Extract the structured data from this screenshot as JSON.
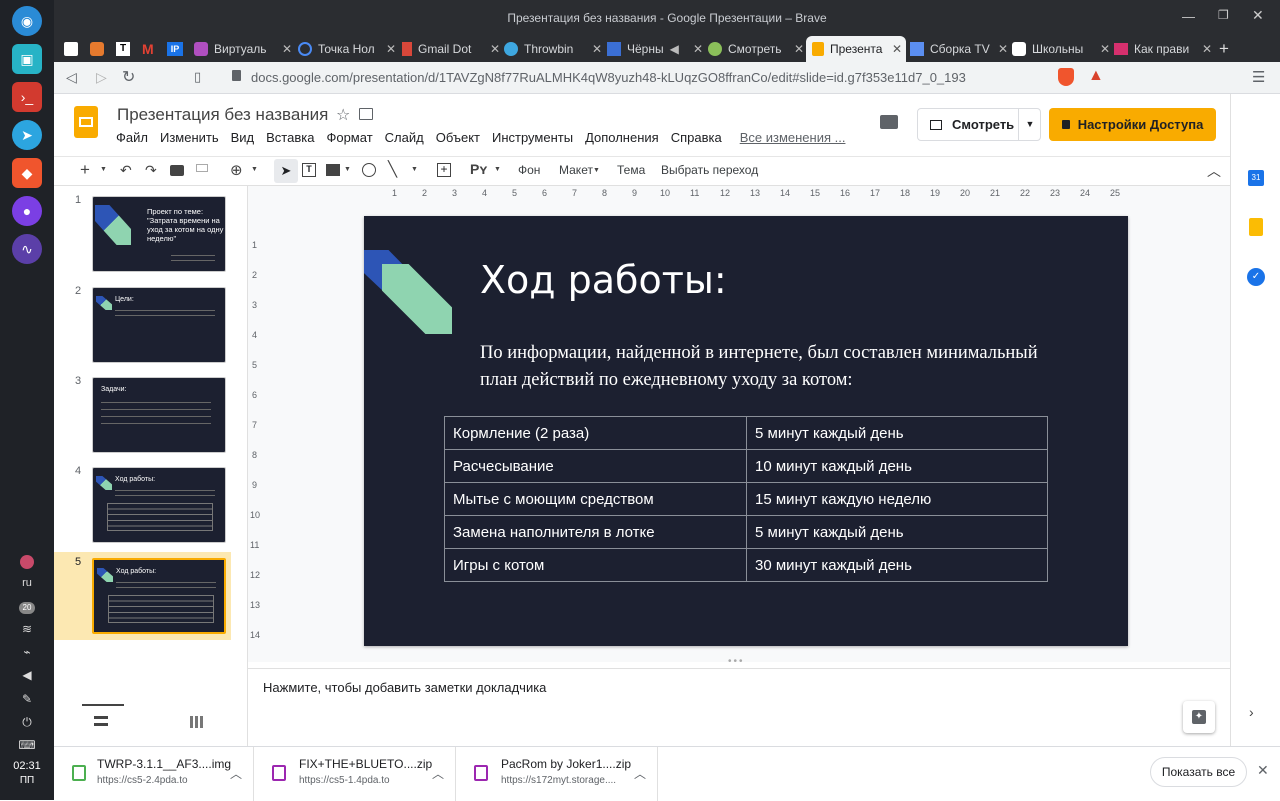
{
  "window": {
    "title": "Презентация без названия - Google Презентации – Brave"
  },
  "os_tray": {
    "lang": "ru",
    "badge": "20",
    "time": "02:31",
    "day": "ПП"
  },
  "tabs": [
    {
      "label": "Виртуаль"
    },
    {
      "label": "Точка Нол"
    },
    {
      "label": "Gmail Dot"
    },
    {
      "label": "Throwbin"
    },
    {
      "label": "Чёрны"
    },
    {
      "label": "Смотреть"
    },
    {
      "label": "Презента"
    },
    {
      "label": "Сборка TV"
    },
    {
      "label": "Школьны"
    },
    {
      "label": "Как прави"
    }
  ],
  "address": {
    "url": "docs.google.com/presentation/d/1TAVZgN8f77RuALMHK4qW8yuzh48-kLUqzGO8ffranCo/edit#slide=id.g7f353e11d7_0_193"
  },
  "doc": {
    "title": "Презентация без названия",
    "menu": [
      "Файл",
      "Изменить",
      "Вид",
      "Вставка",
      "Формат",
      "Слайд",
      "Объект",
      "Инструменты",
      "Дополнения",
      "Справка"
    ],
    "changes_link": "Все изменения ...",
    "present_label": "Смотреть",
    "share_label": "Настройки Доступа"
  },
  "toolbar": {
    "background": "Фон",
    "layout": "Макет",
    "theme": "Тема",
    "transition": "Выбрать переход"
  },
  "ruler": {
    "h": [
      "1",
      "2",
      "3",
      "4",
      "5",
      "6",
      "7",
      "8",
      "9",
      "10",
      "11",
      "12",
      "13",
      "14",
      "15",
      "16",
      "17",
      "18",
      "19",
      "20",
      "21",
      "22",
      "23",
      "24",
      "25"
    ],
    "v": [
      "1",
      "2",
      "3",
      "4",
      "5",
      "6",
      "7",
      "8",
      "9",
      "10",
      "11",
      "12",
      "13",
      "14"
    ]
  },
  "slides": [
    {
      "num": "1",
      "title": "Проект по теме: \"Затрата времени на уход за котом на одну неделю\""
    },
    {
      "num": "2",
      "title": "Цели:"
    },
    {
      "num": "3",
      "title": "Задачи:"
    },
    {
      "num": "4",
      "title": "Ход работы:"
    },
    {
      "num": "5",
      "title": "Ход работы:"
    }
  ],
  "current_slide": {
    "title": "Ход работы:",
    "body": "По информации, найденной в интернете, был составлен минимальный план действий по ежедневному уходу за котом:",
    "rows": [
      {
        "task": "Кормление (2 раза)",
        "time": "5 минут каждый день"
      },
      {
        "task": "Расчесывание",
        "time": "10 минут каждый день"
      },
      {
        "task": "Мытье с моющим средством",
        "time": "15 минут каждую неделю"
      },
      {
        "task": "Замена наполнителя в лотке",
        "time": "5 минут каждый день"
      },
      {
        "task": "Игры с котом",
        "time": "30 минут каждый день"
      }
    ]
  },
  "notes": {
    "placeholder": "Нажмите, чтобы добавить заметки докладчика"
  },
  "downloads": [
    {
      "name": "TWRP-3.1.1__AF3....img",
      "source": "https://cs5-2.4pda.to"
    },
    {
      "name": "FIX+THE+BLUETO....zip",
      "source": "https://cs5-1.4pda.to"
    },
    {
      "name": "PacRom by Joker1....zip",
      "source": "https://s172myt.storage...."
    }
  ],
  "show_all": "Показать все",
  "colors": {
    "accent": "#f9ab00",
    "slide_bg": "#1c2030",
    "selected": "#fce8b2"
  }
}
